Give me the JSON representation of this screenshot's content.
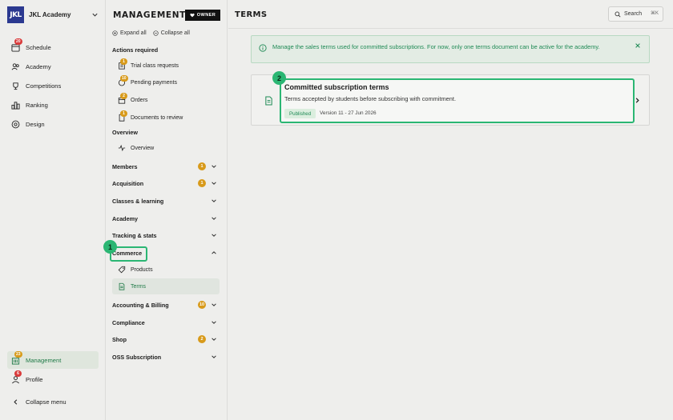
{
  "org": {
    "logo_text": "JKL",
    "name": "JKL Academy"
  },
  "leftnav": {
    "items": [
      {
        "label": "Schedule",
        "badge": "20"
      },
      {
        "label": "Academy",
        "badge": ""
      },
      {
        "label": "Competitions",
        "badge": ""
      },
      {
        "label": "Ranking",
        "badge": ""
      },
      {
        "label": "Design",
        "badge": ""
      }
    ],
    "management": {
      "label": "Management",
      "badge": "23"
    },
    "profile": {
      "label": "Profile",
      "badge": "6"
    },
    "collapse_label": "Collapse menu"
  },
  "midnav": {
    "title": "MANAGEMENT",
    "owner_label": "OWNER",
    "expand_all": "Expand all",
    "collapse_all": "Collapse all",
    "actions_required": {
      "heading": "Actions required",
      "items": [
        {
          "label": "Trial class requests",
          "badge": "1"
        },
        {
          "label": "Pending payments",
          "badge": "10"
        },
        {
          "label": "Orders",
          "badge": "2"
        },
        {
          "label": "Documents to review",
          "badge": "1"
        }
      ]
    },
    "overview": {
      "heading": "Overview",
      "item": "Overview"
    },
    "groups": [
      {
        "label": "Members",
        "badge": "1"
      },
      {
        "label": "Acquisition",
        "badge": "1"
      },
      {
        "label": "Classes & learning",
        "badge": ""
      },
      {
        "label": "Academy",
        "badge": ""
      },
      {
        "label": "Tracking & stats",
        "badge": ""
      },
      {
        "label": "Commerce",
        "badge": ""
      },
      {
        "label": "Accounting & Billing",
        "badge": "10"
      },
      {
        "label": "Compliance",
        "badge": ""
      },
      {
        "label": "Shop",
        "badge": "2"
      },
      {
        "label": "OSS Subscription",
        "badge": ""
      }
    ],
    "commerce_items": [
      {
        "label": "Products"
      },
      {
        "label": "Terms"
      }
    ]
  },
  "main": {
    "title": "TERMS",
    "search_label": "Search",
    "search_kbd": "⌘K",
    "alert": "Manage the sales terms used for committed subscriptions. For now, only one terms document can be active for the academy.",
    "card": {
      "title": "Committed subscription terms",
      "description": "Terms accepted by students before subscribing with commitment.",
      "status": "Published",
      "version": "Version 11 - 27 Jun 2026"
    }
  },
  "steps": [
    "1",
    "2"
  ],
  "colors": {
    "accent": "#2bb673",
    "badge_red": "#d93b3b",
    "badge_amber": "#d89a1a",
    "logo_bg": "#2b3990"
  }
}
